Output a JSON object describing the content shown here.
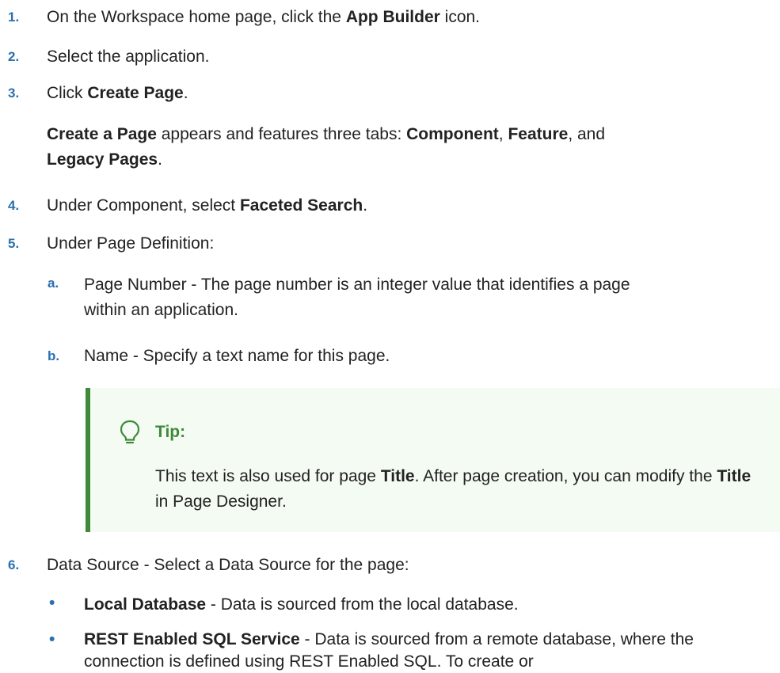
{
  "steps": [
    {
      "num": "1.",
      "pre": "On the Workspace home page, click the ",
      "bold": "App Builder",
      "post": " icon."
    },
    {
      "num": "2.",
      "text": "Select the application."
    },
    {
      "num": "3.",
      "pre": "Click ",
      "bold": "Create Page",
      "post": "."
    },
    {
      "para": {
        "b1": "Create a Page",
        "t1": " appears and features three tabs: ",
        "b2": "Component",
        "t2": ", ",
        "b3": "Feature",
        "t3": ", and ",
        "b4": "Legacy Pages",
        "t4": "."
      }
    },
    {
      "num": "4.",
      "pre": "Under Component, select ",
      "bold": "Faceted Search",
      "post": "."
    },
    {
      "num": "5.",
      "text": "Under Page Definition:"
    },
    {
      "num": "6.",
      "text": "Data Source - Select a Data Source for the page:"
    }
  ],
  "substeps": [
    {
      "num": "a.",
      "line1": "Page Number - The page number is an integer value that identifies a page",
      "line2": "within an application."
    },
    {
      "num": "b.",
      "text": "Name - Specify a text name for this page."
    }
  ],
  "tip": {
    "title": "Tip:",
    "t1": "This text is also used for page ",
    "b1": "Title",
    "t2": ". After page creation, you can modify the ",
    "b2": "Title",
    "t3": " in Page Designer.",
    "icon": "lightbulb-icon",
    "accent": "#3f8a3a"
  },
  "bullets": [
    {
      "bold": "Local Database",
      "text": " - Data is sourced from the local database."
    },
    {
      "bold": "REST Enabled SQL Service",
      "text": " - Data is sourced from a remote database, where the connection is defined using REST Enabled SQL. To create or"
    }
  ],
  "colors": {
    "number": "#2b70b0",
    "tip_background": "#f4fbf2"
  }
}
